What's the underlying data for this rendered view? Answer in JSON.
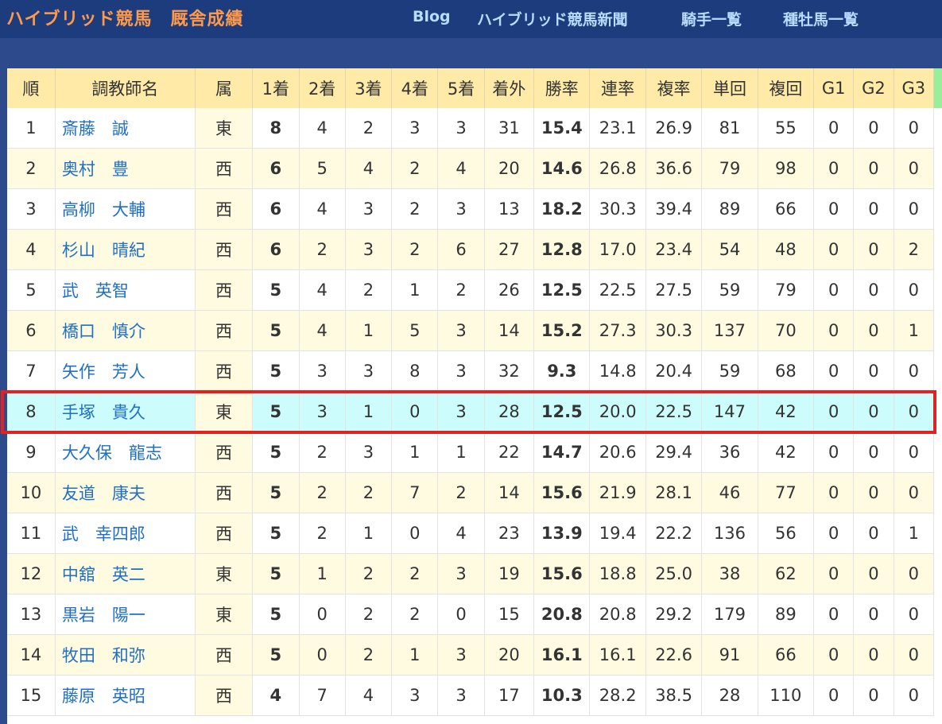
{
  "site": {
    "title": "ハイブリッド競馬　厩舎成績",
    "nav": [
      "Blog",
      "ハイブリッド競馬新聞",
      "騎手一覧",
      "種牡馬一覧"
    ]
  },
  "table": {
    "headers": [
      "順",
      "調教師名",
      "属",
      "1着",
      "2着",
      "3着",
      "4着",
      "5着",
      "着外",
      "勝率",
      "連率",
      "複率",
      "単回",
      "複回",
      "G1",
      "G2",
      "G3"
    ],
    "rows": [
      [
        "1",
        "斎藤　誠",
        "東",
        "8",
        "4",
        "2",
        "3",
        "3",
        "31",
        "15.4",
        "23.1",
        "26.9",
        "81",
        "55",
        "0",
        "0",
        "0"
      ],
      [
        "2",
        "奥村　豊",
        "西",
        "6",
        "5",
        "4",
        "2",
        "4",
        "20",
        "14.6",
        "26.8",
        "36.6",
        "79",
        "98",
        "0",
        "0",
        "0"
      ],
      [
        "3",
        "高柳　大輔",
        "西",
        "6",
        "4",
        "3",
        "2",
        "3",
        "13",
        "18.2",
        "30.3",
        "39.4",
        "89",
        "66",
        "0",
        "0",
        "0"
      ],
      [
        "4",
        "杉山　晴紀",
        "西",
        "6",
        "2",
        "3",
        "2",
        "6",
        "27",
        "12.8",
        "17.0",
        "23.4",
        "54",
        "48",
        "0",
        "0",
        "2"
      ],
      [
        "5",
        "武　英智",
        "西",
        "5",
        "4",
        "2",
        "1",
        "2",
        "26",
        "12.5",
        "22.5",
        "27.5",
        "59",
        "79",
        "0",
        "0",
        "0"
      ],
      [
        "6",
        "橋口　慎介",
        "西",
        "5",
        "4",
        "1",
        "5",
        "3",
        "14",
        "15.2",
        "27.3",
        "30.3",
        "137",
        "70",
        "0",
        "0",
        "1"
      ],
      [
        "7",
        "矢作　芳人",
        "西",
        "5",
        "3",
        "3",
        "8",
        "3",
        "32",
        "9.3",
        "14.8",
        "20.4",
        "59",
        "68",
        "0",
        "0",
        "0"
      ],
      [
        "8",
        "手塚　貴久",
        "東",
        "5",
        "3",
        "1",
        "0",
        "3",
        "28",
        "12.5",
        "20.0",
        "22.5",
        "147",
        "42",
        "0",
        "0",
        "0"
      ],
      [
        "9",
        "大久保　龍志",
        "西",
        "5",
        "2",
        "3",
        "1",
        "1",
        "22",
        "14.7",
        "20.6",
        "29.4",
        "36",
        "42",
        "0",
        "0",
        "0"
      ],
      [
        "10",
        "友道　康夫",
        "西",
        "5",
        "2",
        "2",
        "7",
        "2",
        "14",
        "15.6",
        "21.9",
        "28.1",
        "46",
        "77",
        "0",
        "0",
        "0"
      ],
      [
        "11",
        "武　幸四郎",
        "西",
        "5",
        "2",
        "1",
        "0",
        "4",
        "23",
        "13.9",
        "19.4",
        "22.2",
        "136",
        "56",
        "0",
        "0",
        "1"
      ],
      [
        "12",
        "中舘　英二",
        "東",
        "5",
        "1",
        "2",
        "2",
        "3",
        "19",
        "15.6",
        "18.8",
        "25.0",
        "38",
        "62",
        "0",
        "0",
        "0"
      ],
      [
        "13",
        "黒岩　陽一",
        "東",
        "5",
        "0",
        "2",
        "2",
        "0",
        "15",
        "20.8",
        "20.8",
        "29.2",
        "179",
        "89",
        "0",
        "0",
        "0"
      ],
      [
        "14",
        "牧田　和弥",
        "西",
        "5",
        "0",
        "2",
        "1",
        "3",
        "20",
        "16.1",
        "16.1",
        "22.6",
        "91",
        "66",
        "0",
        "0",
        "0"
      ],
      [
        "15",
        "藤原　英昭",
        "西",
        "4",
        "7",
        "4",
        "3",
        "3",
        "17",
        "10.3",
        "28.2",
        "38.5",
        "28",
        "110",
        "0",
        "0",
        "0"
      ]
    ],
    "highlighted_rank": "8"
  },
  "colors": {
    "header_bar": "#1d3c7e",
    "title": "#ff9a4a",
    "nav": "#b9dcff",
    "table_header": "#ffeaa8",
    "row_alt": "#fffbe0",
    "highlight_row": "#ccfcfc",
    "highlight_border": "#e52020",
    "name_link": "#1f6fc6"
  }
}
